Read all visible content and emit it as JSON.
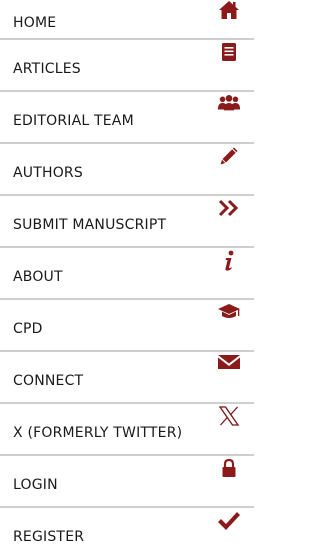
{
  "colors": {
    "accent": "#8b1a1a",
    "divider": "#cfcfcf",
    "text": "#1a1a1a"
  },
  "menu": {
    "items": [
      {
        "label": "HOME",
        "icon": "home-icon"
      },
      {
        "label": "ARTICLES",
        "icon": "document-icon"
      },
      {
        "label": "EDITORIAL TEAM",
        "icon": "users-icon"
      },
      {
        "label": "AUTHORS",
        "icon": "pencil-icon"
      },
      {
        "label": "SUBMIT MANUSCRIPT",
        "icon": "double-chevron-right-icon"
      },
      {
        "label": "ABOUT",
        "icon": "info-icon"
      },
      {
        "label": "CPD",
        "icon": "graduation-cap-icon"
      },
      {
        "label": "CONNECT",
        "icon": "envelope-icon"
      },
      {
        "label": "X (FORMERLY TWITTER)",
        "icon": "x-logo-icon"
      },
      {
        "label": "LOGIN",
        "icon": "lock-icon"
      },
      {
        "label": "REGISTER",
        "icon": "checkmark-icon"
      }
    ]
  }
}
